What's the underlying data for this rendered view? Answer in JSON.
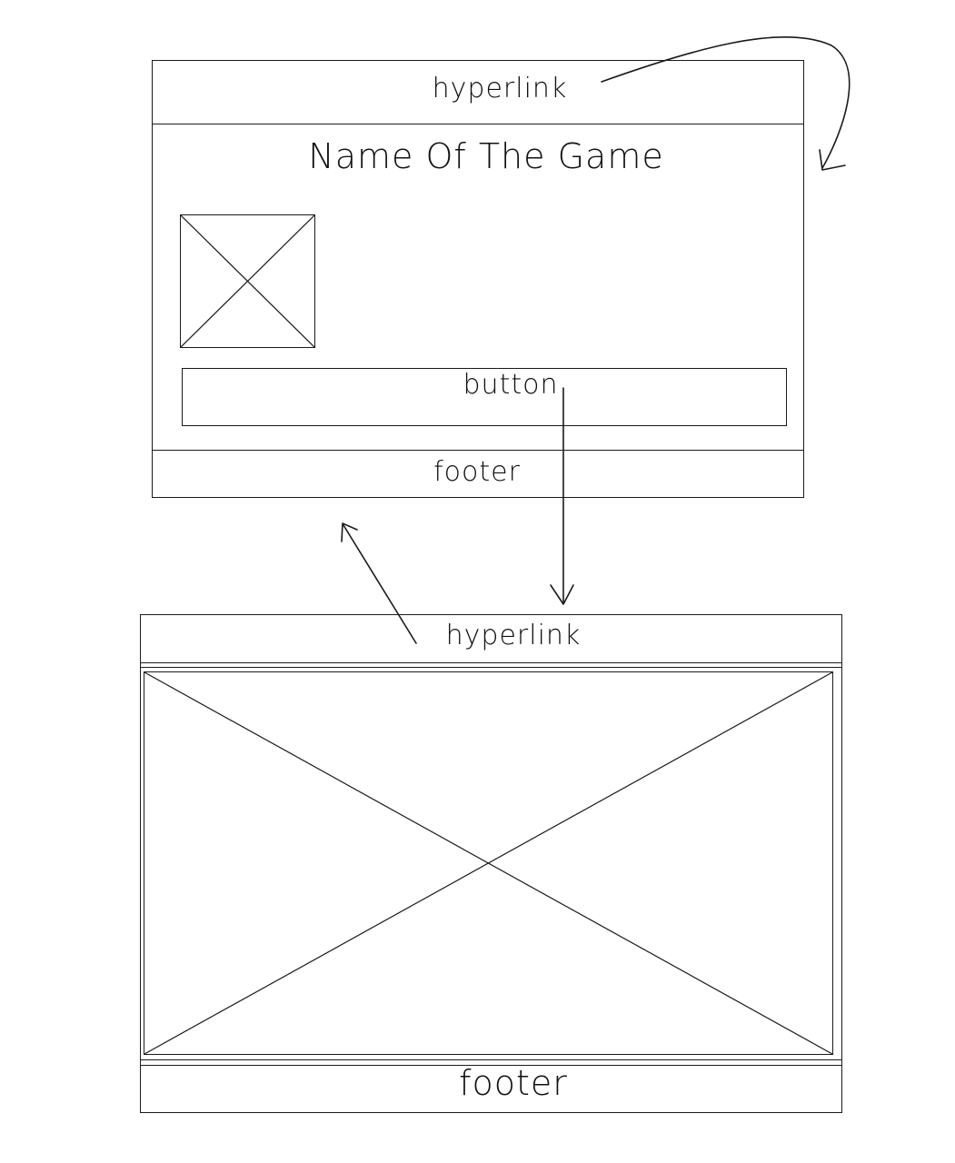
{
  "screen_main": {
    "header_link": "hyperlink",
    "game_title": "Name Of The Game",
    "image_placeholder_icon": "image-placeholder-icon",
    "button_label": "button",
    "footer_label": "footer"
  },
  "screen_game": {
    "header_link": "hyperlink",
    "game_area_placeholder_icon": "image-placeholder-icon",
    "footer_label": "footer"
  },
  "colors": {
    "stroke": "#1a1a1a",
    "background": "#ffffff"
  }
}
